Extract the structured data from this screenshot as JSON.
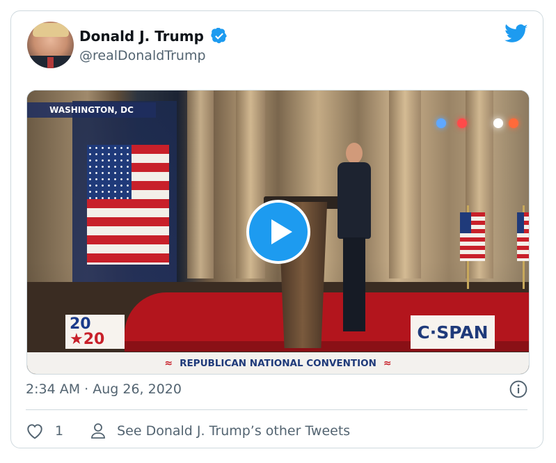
{
  "tweet": {
    "author_name": "Donald J. Trump",
    "author_handle": "@realDonaldTrump",
    "timestamp": "2:34 AM · Aug 26, 2020",
    "like_count": "1",
    "see_other_tweets": "See Donald J. Trump’s other Tweets"
  },
  "media": {
    "location_badge": "WASHINGTON, DC",
    "logo_2020_top": "20",
    "logo_2020_bottom": "★20",
    "network_logo": "C·SPAN",
    "lower_banner": "REPUBLICAN NATIONAL CONVENTION"
  },
  "colors": {
    "twitter_blue": "#1d9bf0",
    "secondary_text": "#536471",
    "border": "#cfd9de"
  },
  "icons": [
    "verified-badge-icon",
    "twitter-bird-icon",
    "play-icon",
    "info-icon",
    "heart-icon",
    "user-icon"
  ]
}
